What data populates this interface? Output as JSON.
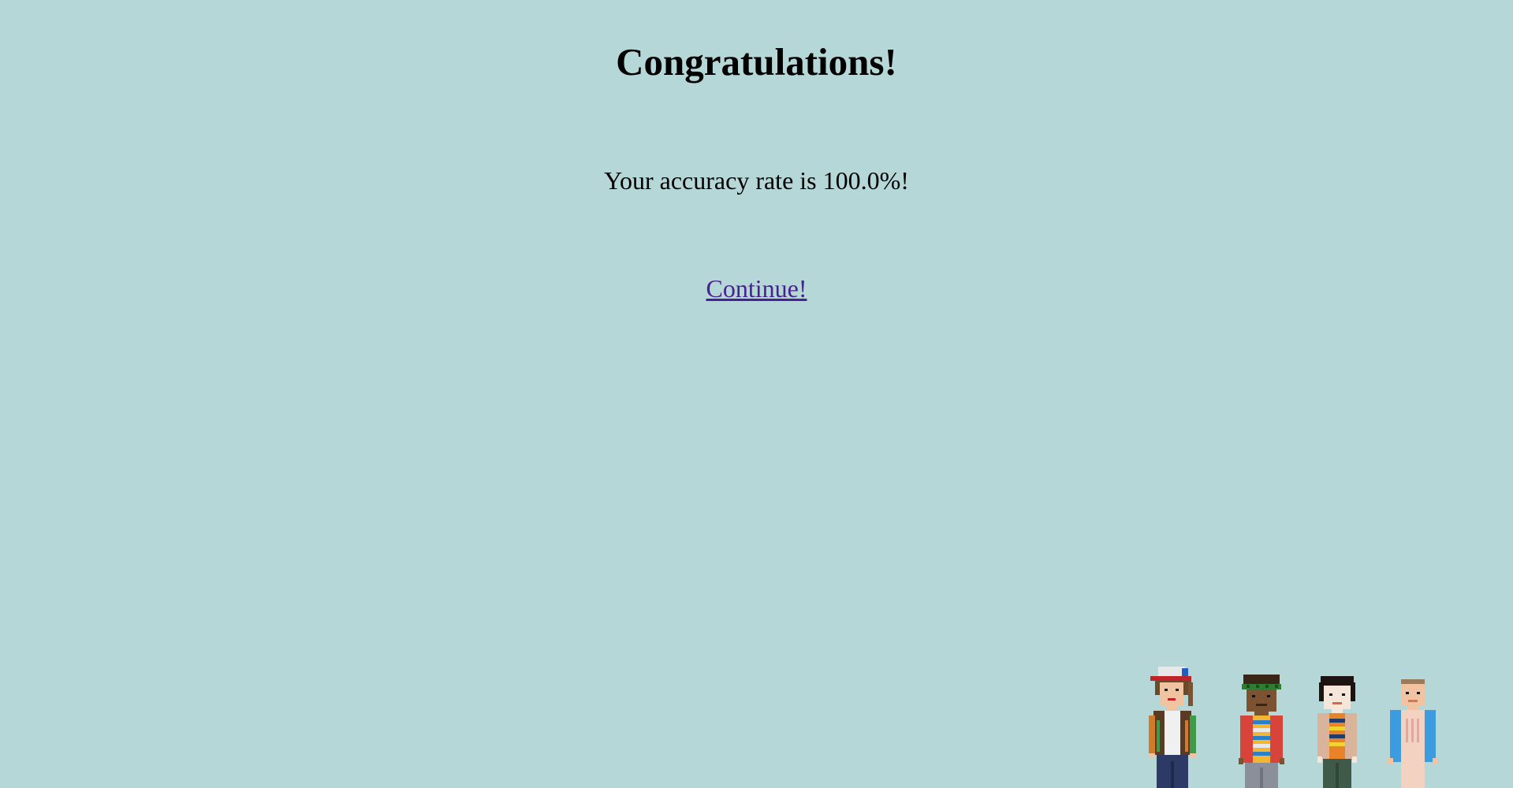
{
  "page": {
    "title": "Congratulations!",
    "message": "Your accuracy rate is 100.0%!",
    "continue_label": "Continue!"
  },
  "characters": [
    {
      "name": "cap-kid-character"
    },
    {
      "name": "headband-kid-character"
    },
    {
      "name": "dark-hair-kid-character"
    },
    {
      "name": "pink-dress-kid-character"
    }
  ]
}
